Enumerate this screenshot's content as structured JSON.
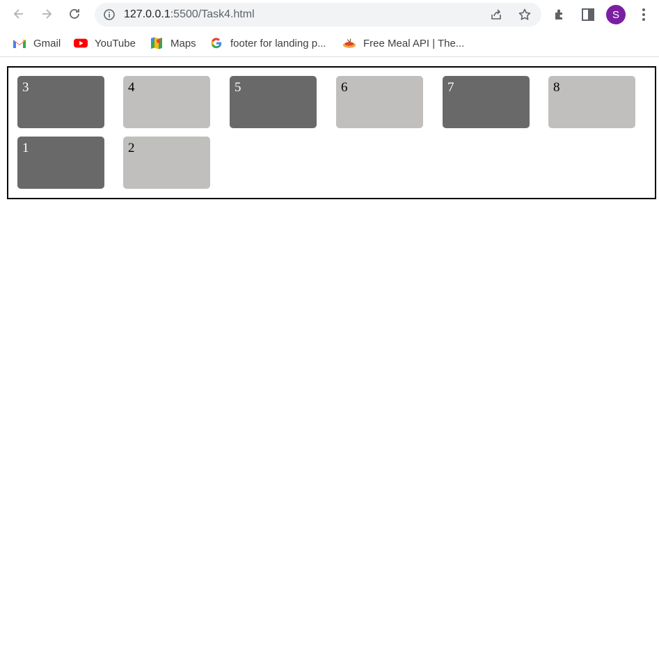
{
  "browser": {
    "url_host": "127.0.0.1",
    "url_rest": ":5500/Task4.html",
    "profile_initial": "S"
  },
  "bookmarks": [
    {
      "label": "Gmail",
      "icon": "gmail-icon"
    },
    {
      "label": "YouTube",
      "icon": "youtube-icon"
    },
    {
      "label": "Maps",
      "icon": "maps-icon"
    },
    {
      "label": "footer for landing p...",
      "icon": "google-icon"
    },
    {
      "label": "Free Meal API | The...",
      "icon": "meal-icon"
    }
  ],
  "colors": {
    "dark_box": "#696969",
    "light_box": "#c0bfbd",
    "avatar": "#7b1fa2"
  },
  "boxes": [
    {
      "label": "3",
      "tone": "dark"
    },
    {
      "label": "4",
      "tone": "light"
    },
    {
      "label": "5",
      "tone": "dark"
    },
    {
      "label": "6",
      "tone": "light"
    },
    {
      "label": "7",
      "tone": "dark"
    },
    {
      "label": "8",
      "tone": "light"
    },
    {
      "label": "1",
      "tone": "dark"
    },
    {
      "label": "2",
      "tone": "light"
    }
  ]
}
